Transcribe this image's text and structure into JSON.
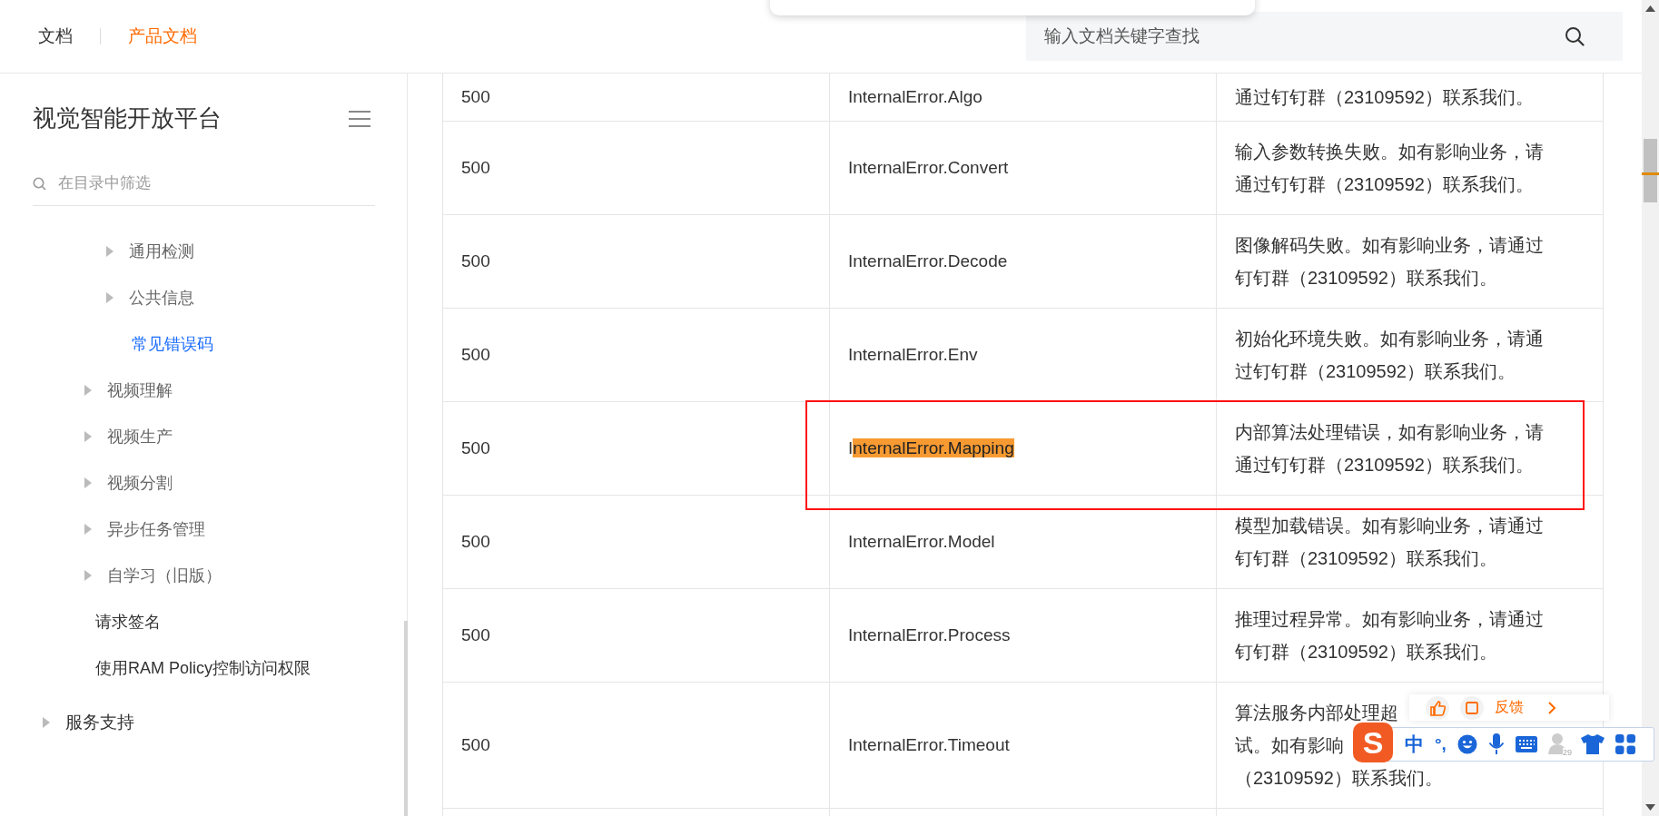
{
  "header": {
    "tabs": [
      {
        "label": "文档",
        "selected": false
      },
      {
        "label": "产品文档",
        "selected": true
      }
    ],
    "search": {
      "placeholder": "输入文档关键字查找"
    }
  },
  "sidebar": {
    "title": "视觉智能开放平台",
    "filter": {
      "placeholder": "在目录中筛选"
    },
    "items": [
      {
        "children": [
          {
            "children": [
              {
                "label": "通用检测",
                "kind": "folder",
                "expanded": false,
                "selected": false
              },
              {
                "label": "公共信息",
                "kind": "folder",
                "expanded": false,
                "selected": false
              },
              {
                "label": "常见错误码",
                "kind": "page",
                "selected": true
              }
            ]
          },
          {
            "label": "视频理解",
            "kind": "folder",
            "expanded": false,
            "selected": false
          },
          {
            "label": "视频生产",
            "kind": "folder",
            "expanded": false,
            "selected": false
          },
          {
            "label": "视频分割",
            "kind": "folder",
            "expanded": false,
            "selected": false
          },
          {
            "label": "异步任务管理",
            "kind": "folder",
            "expanded": false,
            "selected": false
          },
          {
            "label": "自学习（旧版）",
            "kind": "folder",
            "expanded": false,
            "selected": false
          },
          {
            "label": "请求签名",
            "kind": "page",
            "selected": false
          },
          {
            "label": "使用RAM Policy控制访问权限",
            "kind": "page",
            "selected": false
          }
        ]
      },
      {
        "label": "服务支持",
        "kind": "folder",
        "expanded": false,
        "selected": false
      }
    ]
  },
  "table": {
    "rows": [
      {
        "status": "500",
        "code": "InternalError.Algo",
        "description": [
          "通过钉钉群（23109592）联系我们。"
        ]
      },
      {
        "status": "500",
        "code": "InternalError.Convert",
        "description": [
          "输入参数转换失败。如有影响业务，请",
          "通过钉钉群（23109592）联系我们。"
        ]
      },
      {
        "status": "500",
        "code": "InternalError.Decode",
        "description": [
          "图像解码失败。如有影响业务，请通过",
          "钉钉群（23109592）联系我们。"
        ]
      },
      {
        "status": "500",
        "code": "InternalError.Env",
        "description": [
          "初始化环境失败。如有影响业务，请通",
          "过钉钉群（23109592）联系我们。"
        ]
      },
      {
        "status": "500",
        "code": "I",
        "code_match": "nternalError.Mapping",
        "description": [
          "内部算法处理错误，如有影响业务，请",
          "通过钉钉群（23109592）联系我们。"
        ],
        "outlined": true
      },
      {
        "status": "500",
        "code": "InternalError.Model",
        "description": [
          "模型加载错误。如有影响业务，请通过",
          "钉钉群（23109592）联系我们。"
        ]
      },
      {
        "status": "500",
        "code": "InternalError.Process",
        "description": [
          "推理过程异常。如有影响业务，请通过",
          "钉钉群（23109592）联系我们。"
        ]
      },
      {
        "status": "500",
        "code": "InternalError.Timeout",
        "description": [
          "算法服务内部处理超",
          "试。如有影响",
          "（23109592）联系我们。"
        ]
      }
    ]
  },
  "feedback": {
    "label": "反馈"
  },
  "ime": {
    "logo": "S",
    "mode": "中",
    "punctuation": "°,",
    "skin_count": "29"
  }
}
